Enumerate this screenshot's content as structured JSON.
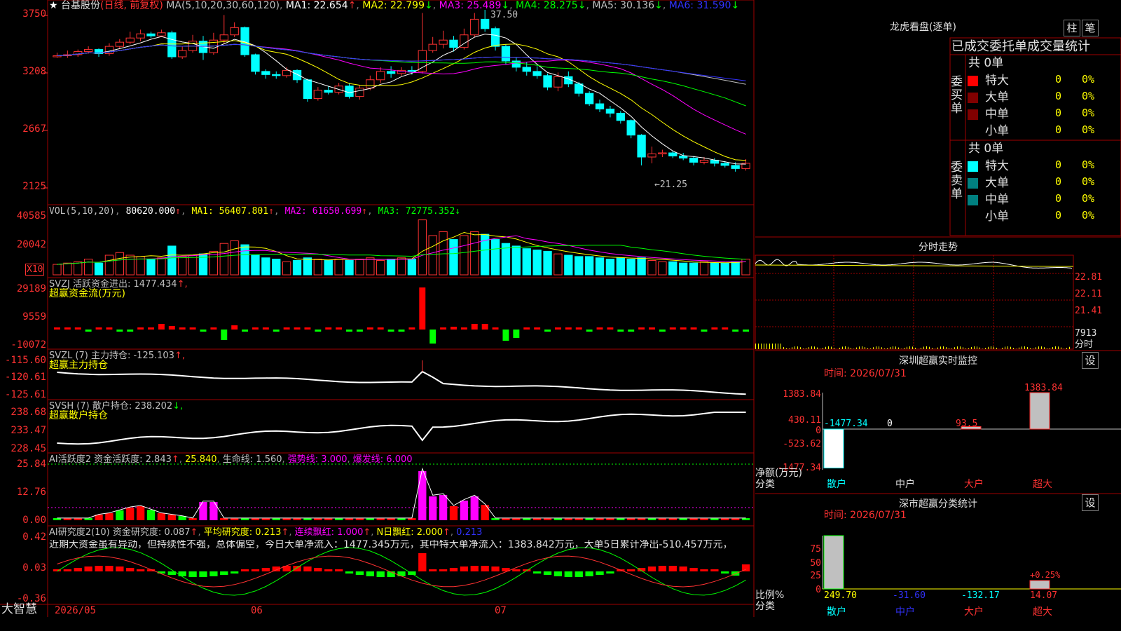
{
  "stock": {
    "star": "★",
    "name": "台基股份",
    "period": "(日线, 前复权)"
  },
  "ma_header": [
    {
      "label": "MA(5,10,20,30,60,120)",
      "color": "#c0c0c0"
    },
    {
      "label": "MA1: 22.654",
      "color": "#ffffff",
      "arrow": "↑",
      "arrow_color": "#ff3232"
    },
    {
      "label": "MA2: 22.799",
      "color": "#ffff00",
      "arrow": "↓",
      "arrow_color": "#00ff00"
    },
    {
      "label": "MA3: 25.489",
      "color": "#ff00ff",
      "arrow": "↓",
      "arrow_color": "#00ff00"
    },
    {
      "label": "MA4: 28.275",
      "color": "#00ff00",
      "arrow": "↓",
      "arrow_color": "#00ff00"
    },
    {
      "label": "MA5: 30.136",
      "color": "#c0c0c0",
      "arrow": "↓",
      "arrow_color": "#00ff00"
    },
    {
      "label": "MA6: 31.590",
      "color": "#3232ff",
      "arrow": "↓",
      "arrow_color": "#00ff00"
    }
  ],
  "price_axis": [
    "3750",
    "3208",
    "2667",
    "2125"
  ],
  "price_marks": {
    "high": "37.50",
    "low": "←21.25"
  },
  "vol": {
    "header": [
      {
        "label": "VOL(5,10,20)",
        "color": "#c0c0c0"
      },
      {
        "label": "80620.000",
        "color": "#ffffff",
        "arrow": "↑",
        "arrow_color": "#ff3232"
      },
      {
        "label": "MA1: 56407.801",
        "color": "#ffff00",
        "arrow": "↑",
        "arrow_color": "#ff3232"
      },
      {
        "label": "MA2: 61650.699",
        "color": "#ff00ff",
        "arrow": "↑",
        "arrow_color": "#ff3232"
      },
      {
        "label": "MA3: 72775.352",
        "color": "#00ff00",
        "arrow": "↓",
        "arrow_color": "#00ff00"
      }
    ],
    "axis": [
      "40585",
      "20042"
    ],
    "unit": "X10"
  },
  "svzj": {
    "header": "SVZJ  活跃资金进出: 1477.434",
    "arrow": "↑",
    "sub": "超赢资金流(万元)",
    "axis": [
      "29189",
      "9559",
      "-10072"
    ]
  },
  "svzl": {
    "header": "SVZL (7) 主力持仓: -125.103",
    "arrow": "↑",
    "sub": "超赢主力持仓",
    "axis": [
      "-115.60",
      "-120.61",
      "-125.61"
    ]
  },
  "svsh": {
    "header": "SVSH (7) 散户持仓: 238.202",
    "arrow": "↓",
    "sub": "超赢散户持仓",
    "axis": [
      "238.68",
      "233.47",
      "228.45"
    ]
  },
  "ai1": {
    "header": [
      {
        "label": "AI活跃度2 资金活跃度: 2.843",
        "color": "#c0c0c0",
        "arrow": "↑",
        "arrow_color": "#ff3232"
      },
      {
        "label": "25.840",
        "color": "#ffff00"
      },
      {
        "label": "生命线: 1.560",
        "color": "#c0c0c0"
      },
      {
        "label": "强势线: 3.000",
        "color": "#ff00ff"
      },
      {
        "label": "爆发线: 6.000",
        "color": "#ff00ff"
      }
    ],
    "axis": [
      "25.84",
      "12.76",
      "0.00"
    ]
  },
  "ai2": {
    "header": [
      {
        "label": "AI研究度2(10) 资金研究度: 0.087",
        "color": "#c0c0c0",
        "arrow": "↑",
        "arrow_color": "#ff3232"
      },
      {
        "label": "平均研究度: 0.213",
        "color": "#ffff00",
        "arrow": "↑",
        "arrow_color": "#ff3232"
      },
      {
        "label": "连续飘红: 1.000",
        "color": "#ff00ff",
        "arrow": "↑",
        "arrow_color": "#ff3232"
      },
      {
        "label": "N日飘红: 2.000",
        "color": "#ffff00",
        "arrow": "↑",
        "arrow_color": "#ff3232"
      },
      {
        "label": "0.213",
        "color": "#3232ff"
      }
    ],
    "note": "近期大资金虽有异动，但持续性不强，总体偏空，今日大单净流入：1477.345万元，其中特大单净流入：1383.842万元，大单5日累计净出-510.457万元，",
    "axis": [
      "0.42",
      "0.03",
      "-0.36"
    ]
  },
  "dates": [
    "2026/05",
    "06",
    "07"
  ],
  "brand": "大智慧",
  "longhu": {
    "title": "龙虎看盘(逐单)",
    "btn1": "柱",
    "btn2": "笔",
    "subtitle": "已成交委托单成交量统计",
    "buy": {
      "side": "委买单",
      "total": "共 0单",
      "rows": [
        {
          "name": "特大",
          "count": "0",
          "pct": "0%",
          "color": "#ff0000"
        },
        {
          "name": "大单",
          "count": "0",
          "pct": "0%",
          "color": "#800000"
        },
        {
          "name": "中单",
          "count": "0",
          "pct": "0%",
          "color": "#800000"
        },
        {
          "name": "小单",
          "count": "0",
          "pct": "0%",
          "color": "#000000"
        }
      ]
    },
    "sell": {
      "side": "委卖单",
      "total": "共 0单",
      "rows": [
        {
          "name": "特大",
          "count": "0",
          "pct": "0%",
          "color": "#00ffff"
        },
        {
          "name": "大单",
          "count": "0",
          "pct": "0%",
          "color": "#008080"
        },
        {
          "name": "中单",
          "count": "0",
          "pct": "0%",
          "color": "#008080"
        },
        {
          "name": "小单",
          "count": "0",
          "pct": "0%",
          "color": "#000000"
        }
      ]
    }
  },
  "intraday": {
    "title": "分时走势",
    "axis": [
      "22.81",
      "22.11",
      "21.41",
      "7913"
    ],
    "unit": "分时"
  },
  "szmon": {
    "title": "深圳超赢实时监控",
    "btn": "设",
    "time": "时间: 2026/07/31",
    "axis": [
      "1383.84",
      "430.11",
      "0",
      "-523.62",
      "-1477.34"
    ],
    "ylabel": "净额(万元)",
    "xlabel": "分类",
    "bars": [
      {
        "cat": "散户",
        "value": -1477.34,
        "label": "-1477.34",
        "color": "#00ffff"
      },
      {
        "cat": "中户",
        "value": 0,
        "label": "0",
        "color": "#ffffff"
      },
      {
        "cat": "大户",
        "value": 93.5,
        "label": "93.5",
        "color": "#ff3232"
      },
      {
        "cat": "超大",
        "value": 1383.84,
        "label": "1383.84",
        "color": "#ff3232"
      }
    ]
  },
  "szclass": {
    "title": "深市超赢分类统计",
    "btn": "设",
    "time": "时间: 2026/07/31",
    "axis": [
      "75",
      "50",
      "25",
      "0"
    ],
    "ylabel": "比例%",
    "xlabel": "分类",
    "pct_label": "+0.25%",
    "bars": [
      {
        "cat": "散户",
        "value": 249.7,
        "label": "249.70",
        "color": "#ffff00"
      },
      {
        "cat": "中户",
        "value": -31.6,
        "label": "-31.60",
        "color": "#3232ff"
      },
      {
        "cat": "大户",
        "value": -132.17,
        "label": "-132.17",
        "color": "#00ffff"
      },
      {
        "cat": "超大",
        "value": 14.07,
        "label": "14.07",
        "color": "#ff3232"
      }
    ]
  },
  "chart_data": {
    "type": "candlestick",
    "ylim": [
      21.25,
      37.5
    ],
    "candles": [
      [
        33.0,
        33.1,
        33.4,
        32.9
      ],
      [
        33.1,
        33.2,
        33.6,
        32.9
      ],
      [
        33.2,
        33.5,
        33.7,
        33.0
      ],
      [
        33.5,
        33.7,
        34.0,
        33.3
      ],
      [
        33.7,
        33.3,
        33.8,
        33.0
      ],
      [
        33.3,
        34.0,
        34.3,
        33.1
      ],
      [
        34.0,
        34.4,
        34.7,
        33.8
      ],
      [
        34.4,
        34.8,
        35.4,
        34.2
      ],
      [
        34.8,
        35.2,
        35.6,
        34.5
      ],
      [
        35.2,
        35.0,
        35.4,
        34.8
      ],
      [
        35.0,
        35.3,
        35.6,
        34.9
      ],
      [
        35.3,
        33.0,
        35.5,
        32.8
      ],
      [
        33.0,
        33.6,
        34.0,
        32.8
      ],
      [
        33.6,
        34.5,
        35.1,
        33.4
      ],
      [
        34.5,
        33.4,
        35.0,
        32.7
      ],
      [
        33.4,
        34.6,
        35.3,
        33.2
      ],
      [
        34.6,
        35.1,
        37.0,
        34.3
      ],
      [
        35.1,
        35.8,
        36.3,
        34.9
      ],
      [
        35.8,
        33.2,
        35.9,
        33.0
      ],
      [
        33.2,
        31.6,
        33.3,
        31.3
      ],
      [
        31.6,
        31.3,
        31.8,
        30.9
      ],
      [
        31.3,
        31.2,
        31.6,
        30.9
      ],
      [
        31.2,
        31.7,
        32.0,
        31.0
      ],
      [
        31.7,
        30.8,
        31.8,
        30.5
      ],
      [
        30.8,
        29.0,
        30.9,
        28.7
      ],
      [
        29.0,
        29.8,
        30.1,
        28.8
      ],
      [
        29.8,
        29.6,
        30.2,
        29.4
      ],
      [
        29.6,
        30.2,
        30.5,
        29.4
      ],
      [
        30.2,
        29.2,
        30.5,
        29.0
      ],
      [
        29.2,
        30.0,
        30.3,
        28.9
      ],
      [
        30.0,
        30.8,
        31.2,
        29.8
      ],
      [
        30.8,
        31.6,
        32.0,
        30.5
      ],
      [
        31.6,
        31.4,
        32.1,
        31.0
      ],
      [
        31.4,
        31.7,
        32.0,
        31.2
      ],
      [
        31.7,
        31.6,
        32.1,
        31.3
      ],
      [
        31.6,
        33.6,
        37.2,
        31.4
      ],
      [
        33.6,
        34.2,
        34.9,
        33.4
      ],
      [
        34.2,
        34.6,
        35.5,
        33.8
      ],
      [
        34.6,
        33.9,
        35.0,
        33.5
      ],
      [
        33.9,
        35.1,
        35.7,
        33.7
      ],
      [
        35.1,
        36.6,
        37.2,
        34.9
      ],
      [
        36.6,
        35.7,
        37.5,
        35.4
      ],
      [
        35.7,
        34.0,
        35.9,
        33.6
      ],
      [
        34.0,
        32.6,
        34.2,
        32.3
      ],
      [
        32.6,
        32.0,
        32.9,
        31.6
      ],
      [
        32.0,
        31.6,
        32.5,
        31.2
      ],
      [
        31.6,
        31.2,
        32.1,
        30.9
      ],
      [
        31.2,
        30.1,
        31.4,
        29.8
      ],
      [
        30.1,
        31.1,
        31.5,
        29.7
      ],
      [
        31.1,
        30.4,
        31.6,
        30.1
      ],
      [
        30.4,
        29.5,
        30.6,
        29.2
      ],
      [
        29.5,
        28.5,
        29.7,
        28.3
      ],
      [
        28.5,
        28.0,
        28.9,
        27.7
      ],
      [
        28.0,
        27.6,
        28.3,
        27.2
      ],
      [
        27.6,
        26.9,
        27.8,
        26.6
      ],
      [
        26.9,
        25.5,
        27.0,
        25.2
      ],
      [
        25.5,
        23.4,
        25.6,
        22.6
      ],
      [
        23.4,
        23.7,
        24.4,
        22.8
      ],
      [
        23.7,
        23.8,
        24.1,
        23.4
      ],
      [
        23.8,
        23.5,
        24.0,
        23.3
      ],
      [
        23.5,
        23.3,
        23.8,
        23.1
      ],
      [
        23.3,
        22.9,
        23.5,
        22.6
      ],
      [
        22.9,
        23.1,
        23.4,
        22.7
      ],
      [
        23.1,
        22.8,
        23.3,
        22.5
      ],
      [
        22.8,
        22.6,
        23.0,
        22.4
      ],
      [
        22.6,
        22.3,
        22.9,
        22.0
      ],
      [
        22.3,
        22.8,
        23.2,
        22.1
      ]
    ]
  }
}
